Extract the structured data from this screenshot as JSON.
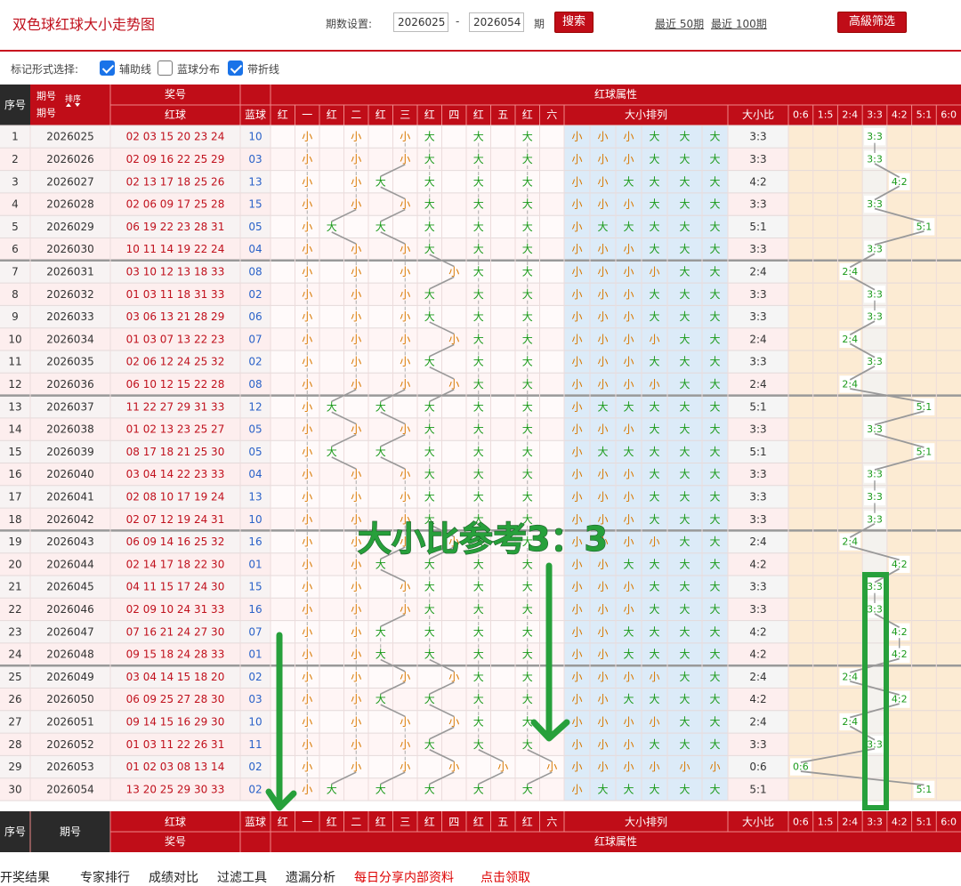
{
  "header": {
    "title": "双色球红球大小走势图",
    "period_label": "期数设置:",
    "start_period": "2026025",
    "dash": "-",
    "end_period": "2026054",
    "period_unit": "期",
    "search_button": "搜索",
    "recent50": "最近 50期",
    "recent100": "最近 100期",
    "advanced_filter": "高級筛选"
  },
  "marks": {
    "label": "标记形式选择:",
    "options": [
      {
        "label": "辅助线",
        "checked": true
      },
      {
        "label": "蓝球分布",
        "checked": false
      },
      {
        "label": "带折线",
        "checked": true
      }
    ]
  },
  "table": {
    "head_seq": "序号",
    "head_period": "期号",
    "head_sort": "排序",
    "head_prize": "奖号",
    "head_red": "红球",
    "head_blue": "蓝球",
    "head_attr": "红球属性",
    "position_heads": [
      "红",
      "一",
      "红",
      "二",
      "红",
      "三",
      "红",
      "四",
      "红",
      "五",
      "红",
      "六"
    ],
    "head_order": "大小排列",
    "head_ratio": "大小比",
    "ratio_cols": [
      "0:6",
      "1:5",
      "2:4",
      "3:3",
      "4:2",
      "5:1",
      "6:0"
    ],
    "rows": [
      {
        "seq": "1",
        "period": "2026025",
        "red": "02 03 15 20 23 24",
        "blue": "10",
        "sizes": [
          "小",
          "小",
          "小",
          "大",
          "大",
          "大"
        ],
        "ratio": "3:3"
      },
      {
        "seq": "2",
        "period": "2026026",
        "red": "02 09 16 22 25 29",
        "blue": "03",
        "sizes": [
          "小",
          "小",
          "小",
          "大",
          "大",
          "大"
        ],
        "ratio": "3:3"
      },
      {
        "seq": "3",
        "period": "2026027",
        "red": "02 13 17 18 25 26",
        "blue": "13",
        "sizes": [
          "小",
          "小",
          "大",
          "大",
          "大",
          "大"
        ],
        "ratio": "4:2"
      },
      {
        "seq": "4",
        "period": "2026028",
        "red": "02 06 09 17 25 28",
        "blue": "15",
        "sizes": [
          "小",
          "小",
          "小",
          "大",
          "大",
          "大"
        ],
        "ratio": "3:3"
      },
      {
        "seq": "5",
        "period": "2026029",
        "red": "06 19 22 23 28 31",
        "blue": "05",
        "sizes": [
          "小",
          "大",
          "大",
          "大",
          "大",
          "大"
        ],
        "ratio": "5:1"
      },
      {
        "seq": "6",
        "period": "2026030",
        "red": "10 11 14 19 22 24",
        "blue": "04",
        "sizes": [
          "小",
          "小",
          "小",
          "大",
          "大",
          "大"
        ],
        "ratio": "3:3"
      },
      {
        "seq": "7",
        "period": "2026031",
        "red": "03 10 12 13 18 33",
        "blue": "08",
        "sizes": [
          "小",
          "小",
          "小",
          "小",
          "大",
          "大"
        ],
        "ratio": "2:4"
      },
      {
        "seq": "8",
        "period": "2026032",
        "red": "01 03 11 18 31 33",
        "blue": "02",
        "sizes": [
          "小",
          "小",
          "小",
          "大",
          "大",
          "大"
        ],
        "ratio": "3:3"
      },
      {
        "seq": "9",
        "period": "2026033",
        "red": "03 06 13 21 28 29",
        "blue": "06",
        "sizes": [
          "小",
          "小",
          "小",
          "大",
          "大",
          "大"
        ],
        "ratio": "3:3"
      },
      {
        "seq": "10",
        "period": "2026034",
        "red": "01 03 07 13 22 23",
        "blue": "07",
        "sizes": [
          "小",
          "小",
          "小",
          "小",
          "大",
          "大"
        ],
        "ratio": "2:4"
      },
      {
        "seq": "11",
        "period": "2026035",
        "red": "02 06 12 24 25 32",
        "blue": "02",
        "sizes": [
          "小",
          "小",
          "小",
          "大",
          "大",
          "大"
        ],
        "ratio": "3:3"
      },
      {
        "seq": "12",
        "period": "2026036",
        "red": "06 10 12 15 22 28",
        "blue": "08",
        "sizes": [
          "小",
          "小",
          "小",
          "小",
          "大",
          "大"
        ],
        "ratio": "2:4"
      },
      {
        "seq": "13",
        "period": "2026037",
        "red": "11 22 27 29 31 33",
        "blue": "12",
        "sizes": [
          "小",
          "大",
          "大",
          "大",
          "大",
          "大"
        ],
        "ratio": "5:1"
      },
      {
        "seq": "14",
        "period": "2026038",
        "red": "01 02 13 23 25 27",
        "blue": "05",
        "sizes": [
          "小",
          "小",
          "小",
          "大",
          "大",
          "大"
        ],
        "ratio": "3:3"
      },
      {
        "seq": "15",
        "period": "2026039",
        "red": "08 17 18 21 25 30",
        "blue": "05",
        "sizes": [
          "小",
          "大",
          "大",
          "大",
          "大",
          "大"
        ],
        "ratio": "5:1"
      },
      {
        "seq": "16",
        "period": "2026040",
        "red": "03 04 14 22 23 33",
        "blue": "04",
        "sizes": [
          "小",
          "小",
          "小",
          "大",
          "大",
          "大"
        ],
        "ratio": "3:3"
      },
      {
        "seq": "17",
        "period": "2026041",
        "red": "02 08 10 17 19 24",
        "blue": "13",
        "sizes": [
          "小",
          "小",
          "小",
          "大",
          "大",
          "大"
        ],
        "ratio": "3:3"
      },
      {
        "seq": "18",
        "period": "2026042",
        "red": "02 07 12 19 24 31",
        "blue": "10",
        "sizes": [
          "小",
          "小",
          "小",
          "大",
          "大",
          "大"
        ],
        "ratio": "3:3"
      },
      {
        "seq": "19",
        "period": "2026043",
        "red": "06 09 14 16 25 32",
        "blue": "16",
        "sizes": [
          "小",
          "小",
          "小",
          "小",
          "大",
          "大"
        ],
        "ratio": "2:4"
      },
      {
        "seq": "20",
        "period": "2026044",
        "red": "02 14 17 18 22 30",
        "blue": "01",
        "sizes": [
          "小",
          "小",
          "大",
          "大",
          "大",
          "大"
        ],
        "ratio": "4:2"
      },
      {
        "seq": "21",
        "period": "2026045",
        "red": "04 11 15 17 24 30",
        "blue": "15",
        "sizes": [
          "小",
          "小",
          "小",
          "大",
          "大",
          "大"
        ],
        "ratio": "3:3"
      },
      {
        "seq": "22",
        "period": "2026046",
        "red": "02 09 10 24 31 33",
        "blue": "16",
        "sizes": [
          "小",
          "小",
          "小",
          "大",
          "大",
          "大"
        ],
        "ratio": "3:3"
      },
      {
        "seq": "23",
        "period": "2026047",
        "red": "07 16 21 24 27 30",
        "blue": "07",
        "sizes": [
          "小",
          "小",
          "大",
          "大",
          "大",
          "大"
        ],
        "ratio": "4:2"
      },
      {
        "seq": "24",
        "period": "2026048",
        "red": "09 15 18 24 28 33",
        "blue": "01",
        "sizes": [
          "小",
          "小",
          "大",
          "大",
          "大",
          "大"
        ],
        "ratio": "4:2"
      },
      {
        "seq": "25",
        "period": "2026049",
        "red": "03 04 14 15 18 20",
        "blue": "02",
        "sizes": [
          "小",
          "小",
          "小",
          "小",
          "大",
          "大"
        ],
        "ratio": "2:4"
      },
      {
        "seq": "26",
        "period": "2026050",
        "red": "06 09 25 27 28 30",
        "blue": "03",
        "sizes": [
          "小",
          "小",
          "大",
          "大",
          "大",
          "大"
        ],
        "ratio": "4:2"
      },
      {
        "seq": "27",
        "period": "2026051",
        "red": "09 14 15 16 29 30",
        "blue": "10",
        "sizes": [
          "小",
          "小",
          "小",
          "小",
          "大",
          "大"
        ],
        "ratio": "2:4"
      },
      {
        "seq": "28",
        "period": "2026052",
        "red": "01 03 11 22 26 31",
        "blue": "11",
        "sizes": [
          "小",
          "小",
          "小",
          "大",
          "大",
          "大"
        ],
        "ratio": "3:3"
      },
      {
        "seq": "29",
        "period": "2026053",
        "red": "01 02 03 08 13 14",
        "blue": "02",
        "sizes": [
          "小",
          "小",
          "小",
          "小",
          "小",
          "小"
        ],
        "ratio": "0:6"
      },
      {
        "seq": "30",
        "period": "2026054",
        "red": "13 20 25 29 30 33",
        "blue": "02",
        "sizes": [
          "小",
          "大",
          "大",
          "大",
          "大",
          "大"
        ],
        "ratio": "5:1"
      }
    ]
  },
  "overlay": {
    "text": "大小比参考3：3"
  },
  "footer": {
    "links": [
      "开奖结果",
      "专家排行",
      "成绩对比",
      "过滤工具",
      "遗漏分析"
    ],
    "promo": "每日分享内部资料",
    "promo2": "点击领取"
  },
  "colors": {
    "brand_red": "#c00d18",
    "small": "#d87800",
    "big": "#1a9a1a",
    "annot_green": "#27a03b"
  }
}
